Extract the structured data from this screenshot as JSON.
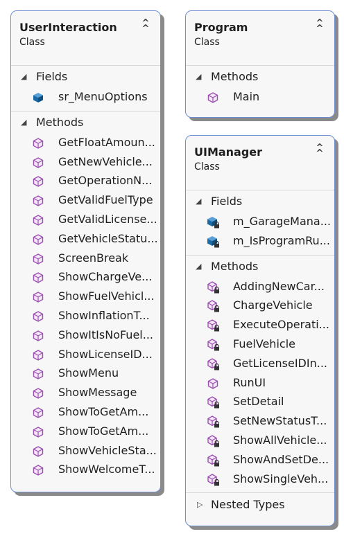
{
  "colors": {
    "border": "#6f8fd3",
    "method_icon": "#9b4fb0",
    "field_icon": "#1a6aa6"
  },
  "classes": [
    {
      "name": "UserInteraction",
      "kind": "Class",
      "fields_label": "Fields",
      "fields": [
        {
          "name": "sr_MenuOptions",
          "icon": "field-icon"
        }
      ],
      "methods_label": "Methods",
      "methods": [
        {
          "name": "GetFloatAmoun...",
          "icon": "method-icon"
        },
        {
          "name": "GetNewVehicle...",
          "icon": "method-icon"
        },
        {
          "name": "GetOperationN...",
          "icon": "method-icon"
        },
        {
          "name": "GetValidFuelType",
          "icon": "method-icon"
        },
        {
          "name": "GetValidLicense...",
          "icon": "method-icon"
        },
        {
          "name": "GetVehicleStatu...",
          "icon": "method-icon"
        },
        {
          "name": "ScreenBreak",
          "icon": "method-icon"
        },
        {
          "name": "ShowChargeVe...",
          "icon": "method-icon"
        },
        {
          "name": "ShowFuelVehicl...",
          "icon": "method-icon"
        },
        {
          "name": "ShowInflationT...",
          "icon": "method-icon"
        },
        {
          "name": "ShowItIsNoFuel...",
          "icon": "method-icon"
        },
        {
          "name": "ShowLicenseID...",
          "icon": "method-icon"
        },
        {
          "name": "ShowMenu",
          "icon": "method-icon"
        },
        {
          "name": "ShowMessage",
          "icon": "method-icon"
        },
        {
          "name": "ShowToGetAm...",
          "icon": "method-icon"
        },
        {
          "name": "ShowToGetAm...",
          "icon": "method-icon"
        },
        {
          "name": "ShowVehicleSta...",
          "icon": "method-icon"
        },
        {
          "name": "ShowWelcomeT...",
          "icon": "method-icon"
        }
      ]
    },
    {
      "name": "Program",
      "kind": "Class",
      "methods_label": "Methods",
      "methods": [
        {
          "name": "Main",
          "icon": "method-icon"
        }
      ]
    },
    {
      "name": "UIManager",
      "kind": "Class",
      "fields_label": "Fields",
      "fields": [
        {
          "name": "m_GarageMana...",
          "icon": "private-field-icon"
        },
        {
          "name": "m_IsProgramRu...",
          "icon": "private-field-icon"
        }
      ],
      "methods_label": "Methods",
      "methods": [
        {
          "name": "AddingNewCar...",
          "icon": "private-method-icon"
        },
        {
          "name": "ChargeVehicle",
          "icon": "private-method-icon"
        },
        {
          "name": "ExecuteOperati...",
          "icon": "private-method-icon"
        },
        {
          "name": "FuelVehicle",
          "icon": "private-method-icon"
        },
        {
          "name": "GetLicenseIDIn...",
          "icon": "private-method-icon"
        },
        {
          "name": "RunUI",
          "icon": "method-icon"
        },
        {
          "name": "SetDetail",
          "icon": "private-method-icon"
        },
        {
          "name": "SetNewStatusT...",
          "icon": "private-method-icon"
        },
        {
          "name": "ShowAllVehicle...",
          "icon": "private-method-icon"
        },
        {
          "name": "ShowAndSetDe...",
          "icon": "private-method-icon"
        },
        {
          "name": "ShowSingleVeh...",
          "icon": "private-method-icon"
        }
      ],
      "nested_label": "Nested Types"
    }
  ]
}
